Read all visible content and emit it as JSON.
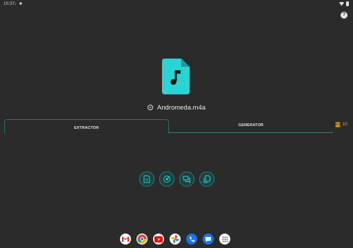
{
  "status_bar": {
    "time": "10:37",
    "icons": "↓ ■"
  },
  "help": {
    "label": "?"
  },
  "file": {
    "name": "Andromeda.m4a",
    "icon": "audio-file-icon",
    "accent": "#2ad4d4"
  },
  "tabs": [
    {
      "label": "EXTRACTOR",
      "selected": true
    },
    {
      "label": "GENERATOR",
      "selected": false
    }
  ],
  "coins": {
    "count": "10",
    "icon": "coins-icon"
  },
  "actions": [
    {
      "icon": "document-icon"
    },
    {
      "icon": "target-icon"
    },
    {
      "icon": "chat-icon"
    },
    {
      "icon": "copy-file-icon"
    }
  ],
  "dock": [
    {
      "app": "gmail-icon",
      "color": "#ffffff"
    },
    {
      "app": "chrome-icon",
      "color": "#ffffff"
    },
    {
      "app": "youtube-icon",
      "color": "#ff0000"
    },
    {
      "app": "photos-icon",
      "color": "#ffffff"
    },
    {
      "app": "phone-icon",
      "color": "#1a73e8"
    },
    {
      "app": "messages-icon",
      "color": "#1a73e8"
    },
    {
      "app": "app-drawer-icon",
      "color": "#ffffff"
    }
  ]
}
